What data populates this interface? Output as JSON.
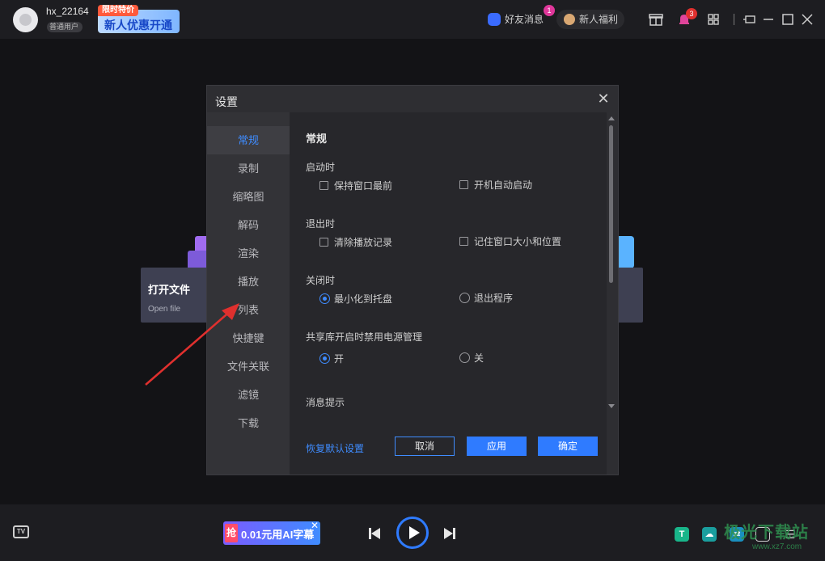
{
  "topbar": {
    "username": "hx_22164",
    "user_level": "普通用户",
    "promo_tag": "限时特价",
    "promo_text": "新人优惠开通",
    "friend_messages": "好友消息",
    "friend_badge": "1",
    "welfare": "新人福利",
    "notification_badge": "3"
  },
  "cards": {
    "open_file_title": "打开文件",
    "open_file_sub": "Open file"
  },
  "settings": {
    "title": "设置",
    "nav": [
      "常规",
      "录制",
      "缩略图",
      "解码",
      "渲染",
      "播放",
      "列表",
      "快捷键",
      "文件关联",
      "滤镜",
      "下载"
    ],
    "active_nav": "常规",
    "section_title": "常规",
    "startup": {
      "label": "启动时",
      "keep_on_top": "保持窗口最前",
      "auto_start": "开机自动启动"
    },
    "exit": {
      "label": "退出时",
      "clear_history": "清除播放记录",
      "remember_window": "记住窗口大小和位置"
    },
    "close": {
      "label": "关闭时",
      "minimize_tray": "最小化到托盘",
      "exit_program": "退出程序",
      "selected": "最小化到托盘"
    },
    "power": {
      "label": "共享库开启时禁用电源管理",
      "on": "开",
      "off": "关",
      "selected": "开"
    },
    "notify_label": "消息提示",
    "restore_default": "恢复默认设置",
    "cancel": "取消",
    "apply": "应用",
    "ok": "确定"
  },
  "bottombar": {
    "ai_tag": "抢",
    "ai_text": "0.01元用AI字幕",
    "tv_label": "TV",
    "watermark": "极光下载站",
    "watermark_url": "www.xz7.com"
  },
  "colors": {
    "accent": "#2f7bff",
    "arrow": "#e0302e"
  }
}
